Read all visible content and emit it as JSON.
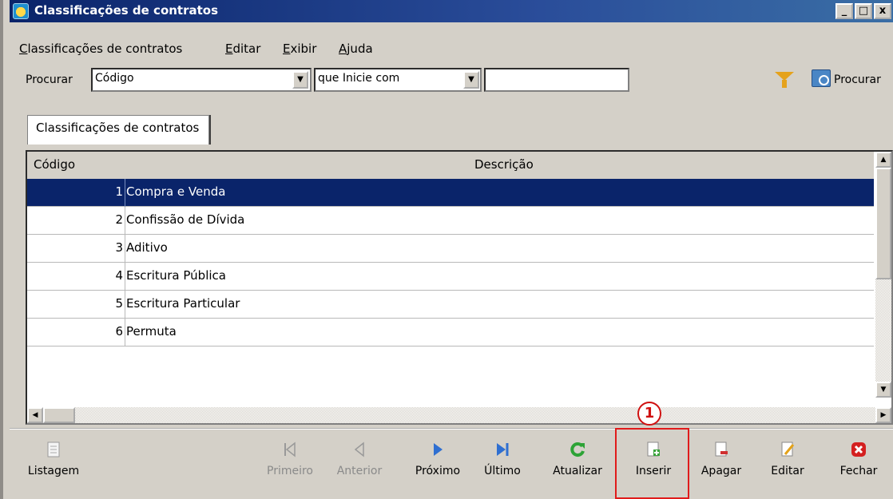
{
  "window": {
    "title": "Classificações de contratos",
    "controls": [
      "_",
      "□",
      "x"
    ]
  },
  "menu": {
    "items": [
      "Classificações de contratos",
      "Editar",
      "Exibir",
      "Ajuda"
    ]
  },
  "search": {
    "label": "Procurar",
    "field_value": "Código",
    "condition_value": "que Inicie com",
    "text_value": "",
    "button_label": "Procurar"
  },
  "tab": {
    "label": "Classificações de contratos"
  },
  "table": {
    "headers": [
      "Código",
      "Descrição"
    ],
    "rows": [
      {
        "code": "1",
        "desc": "Compra e Venda"
      },
      {
        "code": "2",
        "desc": "Confissão de Dívida"
      },
      {
        "code": "3",
        "desc": "Aditivo"
      },
      {
        "code": "4",
        "desc": "Escritura Pública"
      },
      {
        "code": "5",
        "desc": "Escritura Particular"
      },
      {
        "code": "6",
        "desc": "Permuta"
      }
    ]
  },
  "toolbar": {
    "listagem": "Listagem",
    "primeiro": "Primeiro",
    "anterior": "Anterior",
    "proximo": "Próximo",
    "ultimo": "Último",
    "atualizar": "Atualizar",
    "inserir": "Inserir",
    "apagar": "Apagar",
    "editar": "Editar",
    "fechar": "Fechar"
  },
  "annotation": {
    "marker": "1"
  },
  "colors": {
    "selection": "#0a246a",
    "highlight": "#e01b1b"
  }
}
